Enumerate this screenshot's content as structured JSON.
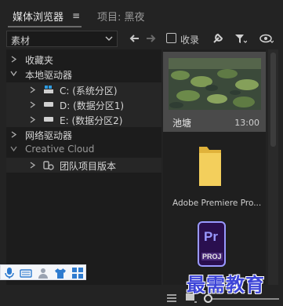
{
  "tabs": [
    {
      "label": "媒体浏览器"
    },
    {
      "label": "项目: 黑夜"
    }
  ],
  "toolbar": {
    "source_value": "素材",
    "collect_label": "收录"
  },
  "tree": {
    "items": [
      {
        "label": "收藏夹"
      },
      {
        "label": "本地驱动器"
      },
      {
        "label": "C: (系统分区)"
      },
      {
        "label": "D: (数据分区1)"
      },
      {
        "label": "E: (数据分区2)"
      },
      {
        "label": "网络驱动器"
      },
      {
        "label": "Creative Cloud"
      },
      {
        "label": "团队项目版本"
      }
    ]
  },
  "thumbnails": [
    {
      "name": "池塘",
      "duration": "13:00",
      "icon": "pond-video-thumbnail"
    },
    {
      "name": "Adobe Premiere Pro...",
      "icon": "folder-icon"
    },
    {
      "name": "",
      "icon": "premiere-proj-icon",
      "badge_text": "Pr",
      "badge_sub": "PROJ"
    }
  ],
  "watermark": "最需教育",
  "colors": {
    "accent_blue": "#2e7bcf",
    "premiere_purple": "#9999ff",
    "premiere_bg": "#2a0f4f",
    "folder_yellow": "#f0c94a"
  }
}
